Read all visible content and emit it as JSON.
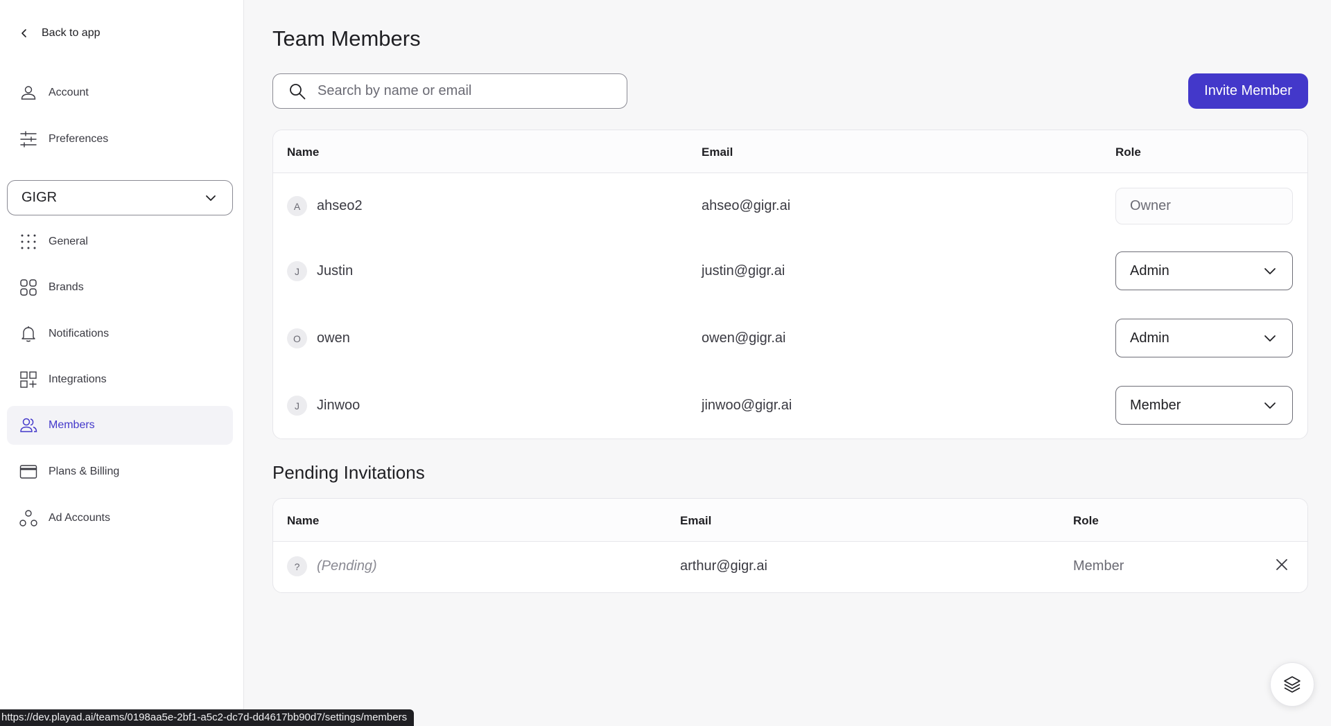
{
  "sidebar": {
    "back_label": "Back to app",
    "items": [
      {
        "label": "Account",
        "icon": "user-icon"
      },
      {
        "label": "Preferences",
        "icon": "sliders-icon"
      }
    ],
    "team": {
      "selected": "GIGR"
    },
    "team_items": [
      {
        "label": "General",
        "icon": "dots-grid-icon"
      },
      {
        "label": "Brands",
        "icon": "brands-grid-icon"
      },
      {
        "label": "Notifications",
        "icon": "bell-icon"
      },
      {
        "label": "Integrations",
        "icon": "integrations-icon"
      },
      {
        "label": "Members",
        "icon": "users-icon",
        "active": true
      },
      {
        "label": "Plans & Billing",
        "icon": "credit-card-icon"
      },
      {
        "label": "Ad Accounts",
        "icon": "ad-accounts-icon"
      }
    ]
  },
  "main": {
    "title": "Team Members",
    "search": {
      "placeholder": "Search by name or email",
      "value": ""
    },
    "invite_label": "Invite Member",
    "members_table": {
      "headers": {
        "name": "Name",
        "email": "Email",
        "role": "Role"
      },
      "rows": [
        {
          "initial": "A",
          "name": "ahseo2",
          "email": "ahseo@gigr.ai",
          "role": "Owner",
          "editable": false
        },
        {
          "initial": "J",
          "name": "Justin",
          "email": "justin@gigr.ai",
          "role": "Admin",
          "editable": true
        },
        {
          "initial": "O",
          "name": "owen",
          "email": "owen@gigr.ai",
          "role": "Admin",
          "editable": true
        },
        {
          "initial": "J",
          "name": "Jinwoo",
          "email": "jinwoo@gigr.ai",
          "role": "Member",
          "editable": true
        }
      ]
    },
    "pending_title": "Pending Invitations",
    "pending_table": {
      "headers": {
        "name": "Name",
        "email": "Email",
        "role": "Role"
      },
      "rows": [
        {
          "initial": "?",
          "name": "(Pending)",
          "email": "arthur@gigr.ai",
          "role": "Member"
        }
      ]
    }
  },
  "status_bar": {
    "url": "https://dev.playad.ai/teams/0198aa5e-2bf1-a5c2-dc7d-dd4617bb90d7/settings/members"
  },
  "colors": {
    "accent": "#4338ca",
    "background": "#f7f7f8",
    "active_nav_bg": "#f3f3f7"
  }
}
